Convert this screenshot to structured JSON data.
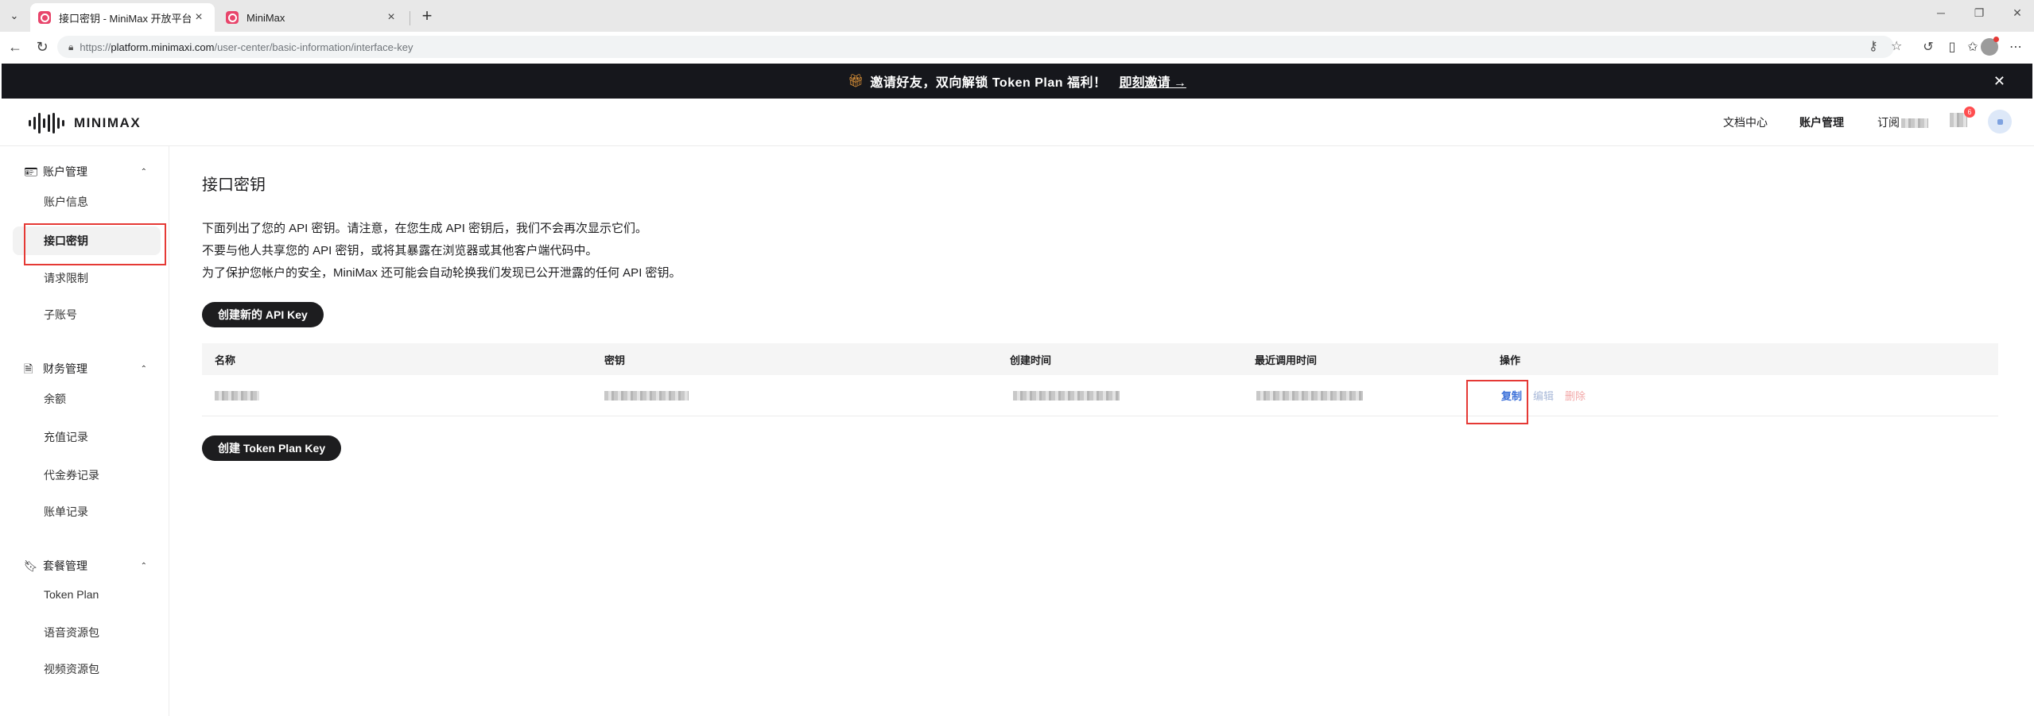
{
  "browser": {
    "tabs": [
      {
        "title": "接口密钥 - MiniMax 开放平台",
        "active": true
      },
      {
        "title": "MiniMax",
        "active": false
      }
    ],
    "url": {
      "protocol": "https://",
      "host": "platform.minimaxi.com",
      "path": "/user-center/basic-information/interface-key"
    }
  },
  "promo": {
    "text": "邀请好友，双向解锁 Token Plan 福利！",
    "link": "即刻邀请 →"
  },
  "header": {
    "logo": "MINIMAX",
    "nav": {
      "docs": "文档中心",
      "account": "账户管理",
      "subscribe": "订阅"
    },
    "badge": "6"
  },
  "sidebar": {
    "groups": [
      {
        "label": "账户管理",
        "icon": "id-card-icon",
        "items": [
          {
            "label": "账户信息"
          },
          {
            "label": "接口密钥",
            "active": true
          },
          {
            "label": "请求限制"
          },
          {
            "label": "子账号"
          }
        ]
      },
      {
        "label": "财务管理",
        "icon": "ledger-icon",
        "items": [
          {
            "label": "余额"
          },
          {
            "label": "充值记录"
          },
          {
            "label": "代金券记录"
          },
          {
            "label": "账单记录"
          }
        ]
      },
      {
        "label": "套餐管理",
        "icon": "bookmark-icon",
        "items": [
          {
            "label": "Token Plan"
          },
          {
            "label": "语音资源包"
          },
          {
            "label": "视频资源包"
          }
        ]
      }
    ]
  },
  "main": {
    "title": "接口密钥",
    "description": [
      "下面列出了您的 API 密钥。请注意，在您生成 API 密钥后，我们不会再次显示它们。",
      "不要与他人共享您的 API 密钥，或将其暴露在浏览器或其他客户端代码中。",
      "为了保护您帐户的安全，MiniMax 还可能会自动轮换我们发现已公开泄露的任何 API 密钥。"
    ],
    "create_api_key_button": "创建新的 API Key",
    "create_token_plan_key_button": "创建 Token Plan Key",
    "table": {
      "columns": [
        "名称",
        "密钥",
        "创建时间",
        "最近调用时间",
        "操作"
      ],
      "rows": [
        {
          "actions": {
            "copy": "复制",
            "edit": "编辑",
            "delete": "删除"
          }
        }
      ]
    }
  },
  "colors": {
    "accent_link": "#3a6fd8",
    "dark_button": "#1d1d1f",
    "highlight_box": "#e53935",
    "promo_bar": "#16171c"
  }
}
